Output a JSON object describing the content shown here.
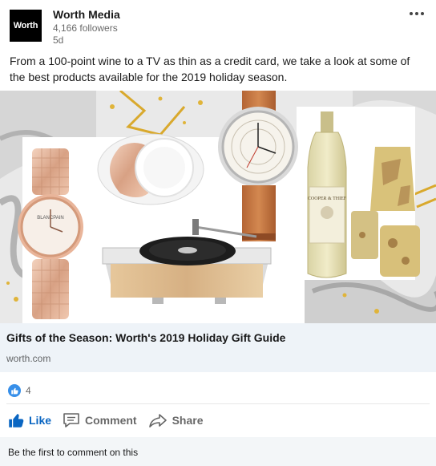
{
  "author": {
    "logo_text": "Worth",
    "name": "Worth Media",
    "followers": "4,166 followers",
    "time": "5d"
  },
  "post": {
    "text": "From a 100-point wine to a TV as thin as a credit card, we take a look at some of the best products available for the 2019 holiday season."
  },
  "image": {
    "bottle_label": "COOPER & THIEF",
    "watch_brand": "BLANCPAIN"
  },
  "link": {
    "title": "Gifts of the Season: Worth's 2019 Holiday Gift Guide",
    "domain": "worth.com"
  },
  "social": {
    "reaction_count": "4"
  },
  "actions": {
    "like": "Like",
    "comment": "Comment",
    "share": "Share"
  },
  "comments": {
    "prompt": "Be the first to comment on this"
  },
  "colors": {
    "accent": "#0a66c2",
    "like_badge": "#378fe9",
    "card_bg": "#eef3f8"
  }
}
